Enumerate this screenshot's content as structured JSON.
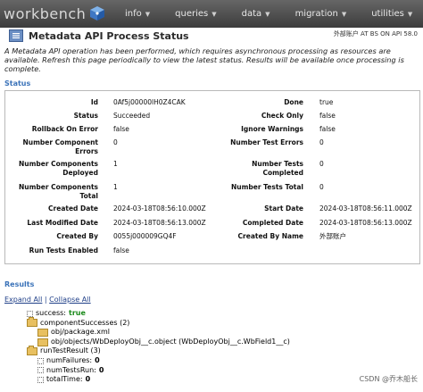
{
  "app": {
    "logo": "workbench"
  },
  "nav": [
    {
      "label": "info"
    },
    {
      "label": "queries"
    },
    {
      "label": "data"
    },
    {
      "label": "migration"
    },
    {
      "label": "utilities"
    }
  ],
  "user_line": "外部账户 AT BS ON API 58.0",
  "page_title": "Metadata API Process Status",
  "description": "A Metadata API operation has been performed, which requires asynchronous processing as resources are available. Refresh this page periodically to view the latest status. Results will be available once processing is complete.",
  "status_section": "Status",
  "status_left": [
    {
      "label": "Id",
      "value": "0Af5j00000lH0Z4CAK"
    },
    {
      "label": "Status",
      "value": "Succeeded"
    },
    {
      "label": "Rollback On Error",
      "value": "false"
    },
    {
      "label": "Number Component Errors",
      "value": "0"
    },
    {
      "label": "Number Components Deployed",
      "value": "1"
    },
    {
      "label": "Number Components Total",
      "value": "1"
    },
    {
      "label": "Created Date",
      "value": "2024-03-18T08:56:10.000Z"
    },
    {
      "label": "Last Modified Date",
      "value": "2024-03-18T08:56:13.000Z"
    },
    {
      "label": "Created By",
      "value": "0055j000009GQ4F"
    },
    {
      "label": "Run Tests Enabled",
      "value": "false"
    }
  ],
  "status_right": [
    {
      "label": "Done",
      "value": "true"
    },
    {
      "label": "Check Only",
      "value": "false"
    },
    {
      "label": "Ignore Warnings",
      "value": "false"
    },
    {
      "label": "Number Test Errors",
      "value": "0"
    },
    {
      "label": "Number Tests Completed",
      "value": "0"
    },
    {
      "label": "Number Tests Total",
      "value": "0"
    },
    {
      "label": "Start Date",
      "value": "2024-03-18T08:56:11.000Z"
    },
    {
      "label": "Completed Date",
      "value": "2024-03-18T08:56:13.000Z"
    },
    {
      "label": "Created By Name",
      "value": "外部账户"
    }
  ],
  "results_section": "Results",
  "expand_all": "Expand All",
  "separator": " | ",
  "collapse_all": "Collapse All",
  "tree": {
    "success_key": "success:",
    "success_val": "true",
    "component_successes": "componentSuccesses (2)",
    "item1": "obj/package.xml",
    "item2": "obj/objects/WbDeployObj__c.object (WbDeployObj__c.WbField1__c)",
    "run_test_result": "runTestResult (3)",
    "num_failures_key": "numFailures:",
    "num_failures_val": "0",
    "num_tests_run_key": "numTestsRun:",
    "num_tests_run_val": "0",
    "total_time_key": "totalTime:",
    "total_time_val": "0"
  },
  "watermark": "CSDN @乔木船长"
}
